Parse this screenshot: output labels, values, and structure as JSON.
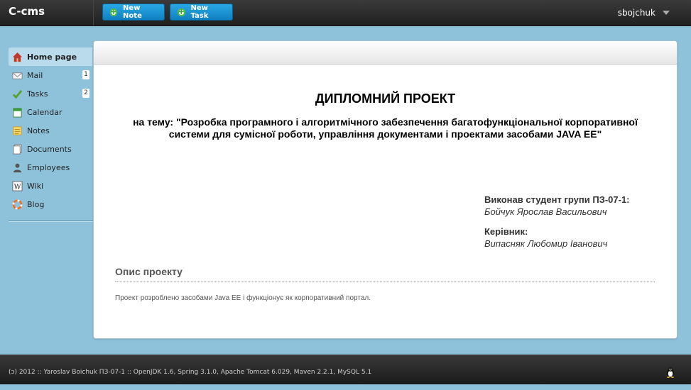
{
  "topbar": {
    "brand": "C-cms",
    "new_note_label": "New Note",
    "new_task_label": "New Task",
    "username": "sbojchuk"
  },
  "sidebar": {
    "items": [
      {
        "label": "Home page",
        "icon": "home-icon",
        "active": true
      },
      {
        "label": "Mail",
        "icon": "mail-icon",
        "badge": "1"
      },
      {
        "label": "Tasks",
        "icon": "checkmark-icon",
        "badge": "2"
      },
      {
        "label": "Calendar",
        "icon": "calendar-icon"
      },
      {
        "label": "Notes",
        "icon": "notes-icon"
      },
      {
        "label": "Documents",
        "icon": "documents-icon"
      },
      {
        "label": "Employees",
        "icon": "user-icon"
      },
      {
        "label": "Wiki",
        "icon": "wiki-icon"
      },
      {
        "label": "Blog",
        "icon": "lifebuoy-icon"
      }
    ]
  },
  "content": {
    "title": "ДИПЛОМНИЙ ПРОЕКТ",
    "subject_line1": "на тему: \"Розробка програмного і алгоритмічного забезпечення багатофункціональної корпоративної",
    "subject_line2": "системи для сумісної роботи, управління документами і проектами засобами JAVA EE\"",
    "student_label": "Виконав студент групи ПЗ-07-1:",
    "student_name": "Бойчук Ярослав Васильович",
    "advisor_label": "Керівник:",
    "advisor_name": "Випасняк Любомир Іванович",
    "section_title": "Опис проекту",
    "section_text": "Проект розроблено засобами Java EE і функціонує як корпоративний портал."
  },
  "footer": {
    "text": "(ɔ) 2012 :: Yaroslav Boichuk ПЗ-07-1 :: OpenJDK 1.6, Spring 3.1.0, Apache Tomcat 6.029, Maven 2.2.1, MySQL 5.1"
  }
}
